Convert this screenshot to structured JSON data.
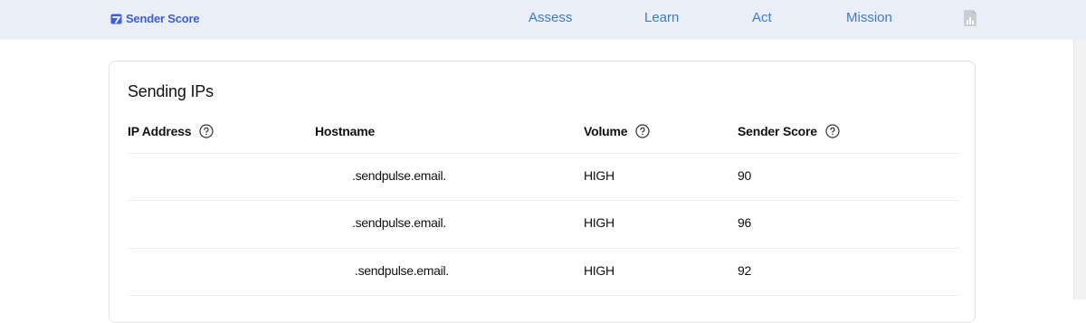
{
  "header": {
    "brand": "Sender Score",
    "nav": [
      "Assess",
      "Learn",
      "Act",
      "Mission"
    ],
    "report_icon": "bar-chart-document-icon",
    "brand_color": "#3c5fd8",
    "link_color": "#3f7cc7"
  },
  "card": {
    "title": "Sending IPs",
    "columns": {
      "ip": "IP Address",
      "hostname": "Hostname",
      "volume": "Volume",
      "score": "Sender Score"
    },
    "help_icon": "question-circle-icon",
    "rows": [
      {
        "ip": "",
        "hostname": ".sendpulse.email.",
        "volume": "HIGH",
        "score": "90"
      },
      {
        "ip": "",
        "hostname": ".sendpulse.email.",
        "volume": "HIGH",
        "score": "96"
      },
      {
        "ip": "",
        "hostname": ".sendpulse.email.",
        "volume": "HIGH",
        "score": "92"
      }
    ]
  }
}
